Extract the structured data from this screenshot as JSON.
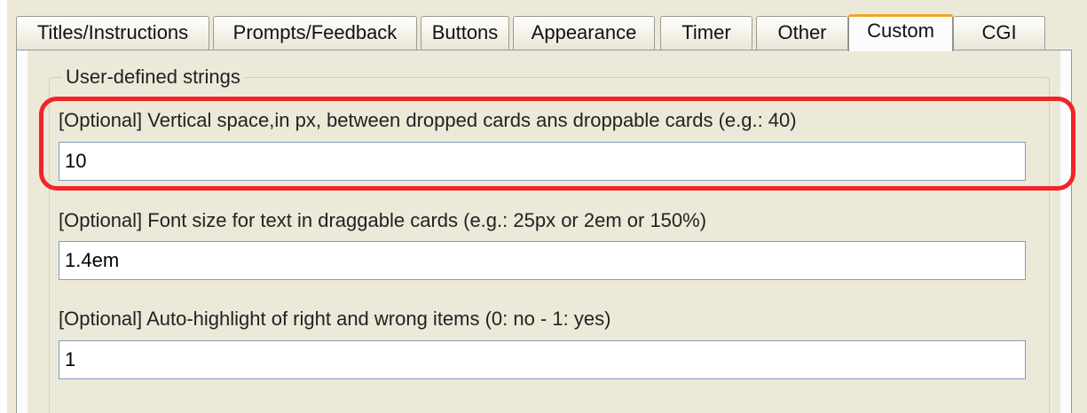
{
  "tabs": [
    {
      "label": "Titles/Instructions",
      "active": false
    },
    {
      "label": "Prompts/Feedback",
      "active": false
    },
    {
      "label": "Buttons",
      "active": false
    },
    {
      "label": "Appearance",
      "active": false
    },
    {
      "label": "Timer",
      "active": false
    },
    {
      "label": "Other",
      "active": false
    },
    {
      "label": "Custom",
      "active": true
    },
    {
      "label": "CGI",
      "active": false
    }
  ],
  "group": {
    "title": "User-defined strings"
  },
  "fields": [
    {
      "label": "[Optional] Vertical space,in px, between dropped cards ans droppable cards (e.g.: 40)",
      "value": "10",
      "highlighted": true
    },
    {
      "label": "[Optional] Font size for text in draggable cards (e.g.: 25px or 2em or 150%)",
      "value": "1.4em",
      "highlighted": false
    },
    {
      "label": "[Optional] Auto-highlight of right and wrong items (0: no - 1: yes)",
      "value": "1",
      "highlighted": false
    }
  ],
  "colors": {
    "window_bg": "#ece9d8",
    "active_tab_accent": "#f5a623",
    "highlight": "#f0242a",
    "input_border": "#7f9db9"
  }
}
